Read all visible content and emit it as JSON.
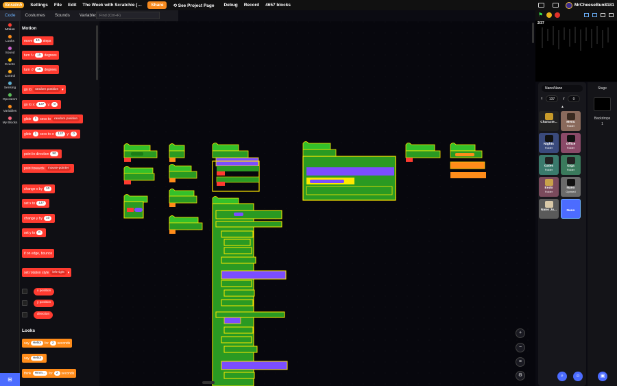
{
  "menubar": {
    "logo": "Scratch",
    "settings": "Settings",
    "file": "File",
    "edit": "Edit",
    "project_title": "The Week with Scratchie (and...",
    "share": "Share",
    "see_project_page": "See Project Page",
    "debug": "Debug",
    "record": "Record",
    "block_count": "4657 blocks",
    "username": "MrCheeseBun8181"
  },
  "tabs": {
    "code": "Code",
    "costumes": "Costumes",
    "sounds": "Sounds",
    "variables": "Variables"
  },
  "find": {
    "placeholder": "Find (Ctrl+F)"
  },
  "categories": [
    {
      "label": "Motion",
      "color": "#ff3b30"
    },
    {
      "label": "Looks",
      "color": "#ff8c1a"
    },
    {
      "label": "Sound",
      "color": "#cf63cf"
    },
    {
      "label": "Events",
      "color": "#ffbf00"
    },
    {
      "label": "Control",
      "color": "#ffab19"
    },
    {
      "label": "Sensing",
      "color": "#5cb1d6"
    },
    {
      "label": "Operators",
      "color": "#59c059"
    },
    {
      "label": "Variables",
      "color": "#ff8c1a"
    },
    {
      "label": "My Blocks",
      "color": "#ff6680"
    }
  ],
  "palette": {
    "motion_header": "Motion",
    "looks_header": "Looks",
    "move": {
      "pre": "move",
      "val": "10",
      "post": "steps"
    },
    "turn_right": {
      "pre": "turn",
      "val": "15",
      "post": "degrees"
    },
    "turn_left": {
      "pre": "turn",
      "val": "15",
      "post": "degrees"
    },
    "goto": {
      "pre": "go to",
      "dd": "random position"
    },
    "goto_xy": {
      "pre": "go to x:",
      "x": "137",
      "ylab": "y:",
      "y": "0"
    },
    "glide_to": {
      "pre": "glide",
      "val": "1",
      "mid": "secs to",
      "dd": "random position"
    },
    "glide_xy": {
      "pre": "glide",
      "val": "1",
      "mid": "secs to x:",
      "x": "137",
      "ylab": "y:",
      "y": "0"
    },
    "point_dir": {
      "pre": "point in direction",
      "val": "90"
    },
    "point_towards": {
      "pre": "point towards",
      "dd": "mouse-pointer"
    },
    "change_x": {
      "pre": "change x by",
      "val": "10"
    },
    "set_x": {
      "pre": "set x to",
      "val": "137"
    },
    "change_y": {
      "pre": "change y by",
      "val": "10"
    },
    "set_y": {
      "pre": "set y to",
      "val": "0"
    },
    "bounce": "if on edge, bounce",
    "rotation": {
      "pre": "set rotation style",
      "dd": "left-right"
    },
    "x_position": "x position",
    "y_position": "y position",
    "direction": "direction",
    "say_for": {
      "pre": "say",
      "val": "Hello!",
      "mid": "for",
      "secs": "2",
      "post": "seconds"
    },
    "say": {
      "pre": "say",
      "val": "Hello!"
    },
    "think_for": {
      "pre": "think",
      "val": "Hmm...",
      "mid": "for",
      "secs": "2",
      "post": "seconds"
    }
  },
  "stage": {
    "fps": "2/37"
  },
  "sprite_info": {
    "name": "Nano/Nano",
    "x_label": "x",
    "x": "137",
    "y_label": "y",
    "y": "0"
  },
  "sprites": [
    {
      "name": "Characte...",
      "sub": ""
    },
    {
      "name": "Menu",
      "sub": "Folder"
    },
    {
      "name": "Nights",
      "sub": "Folder"
    },
    {
      "name": "Office",
      "sub": "Folder"
    },
    {
      "name": "Gates",
      "sub": "Folder"
    },
    {
      "name": "Giga",
      "sub": "Folder"
    },
    {
      "name": "Endo",
      "sub": "Folder"
    },
    {
      "name": "Nano",
      "sub": "Opened"
    },
    {
      "name": "Nano Ju...",
      "sub": ""
    },
    {
      "name": "Nano",
      "sub": ""
    }
  ],
  "stage_pane": {
    "label": "Stage",
    "backdrops_label": "Backdrops",
    "backdrops_count": "1"
  },
  "zoom": {
    "in": "+",
    "out": "−",
    "reset": "="
  }
}
